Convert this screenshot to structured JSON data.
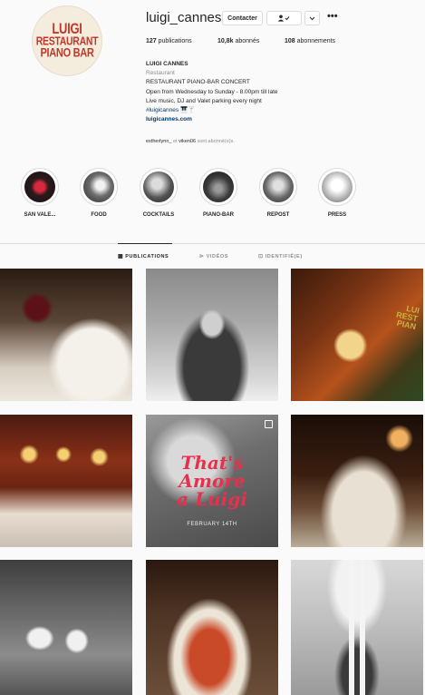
{
  "profile": {
    "username": "luigi_cannes",
    "avatar_lines": [
      "LUIGI",
      "RESTAURANT",
      "PIANO BAR"
    ],
    "contact_label": "Contacter",
    "follow_icon": "person-check-icon",
    "more_icon": "chevron-down-icon",
    "options_icon": "more-dots-icon",
    "options_label": "•••"
  },
  "stats": {
    "posts_count": "127",
    "posts_label": "publications",
    "followers_count": "10,8k",
    "followers_label": "abonnés",
    "following_count": "108",
    "following_label": "abonnements"
  },
  "bio": {
    "name": "LUIGI CANNES",
    "category": "Restaurant",
    "line1": "RESTAURANT PIANO-BAR CONCERT",
    "line2": "Open from Wednesday to Sunday - 8.00pm till late",
    "line3": "Live music, DJ and Valet parking every night",
    "hashtag": "#luigicannes",
    "hashtag_emoji": "🎹🍸",
    "link": "luigicannes.com",
    "followed_user1": "extherlynn_",
    "followed_and": "et",
    "followed_user2": "viken06",
    "followed_suffix": "sont abonné(e)s."
  },
  "highlights": [
    {
      "label": "SAN VALE..."
    },
    {
      "label": "FOOD"
    },
    {
      "label": "COCKTAILS"
    },
    {
      "label": "PIANO-BAR"
    },
    {
      "label": "REPOST"
    },
    {
      "label": "PRESS"
    }
  ],
  "tabs": [
    {
      "label": "PUBLICATIONS",
      "icon": "grid-icon"
    },
    {
      "label": "VIDÉOS",
      "icon": "video-icon"
    },
    {
      "label": "IDENTIFIÉ(E)",
      "icon": "tag-icon"
    }
  ],
  "posts": {
    "valentine_text1": "That's",
    "valentine_text2": "Amore",
    "valentine_text3": "a Luigi",
    "valentine_date": "FEBRUARY 14TH",
    "notebook_text1": "LUI",
    "notebook_text2": "REST",
    "notebook_text3": "PIAN"
  },
  "colors": {
    "background": "#fafafa",
    "link": "#00376b",
    "brand_red": "#c0392b"
  }
}
